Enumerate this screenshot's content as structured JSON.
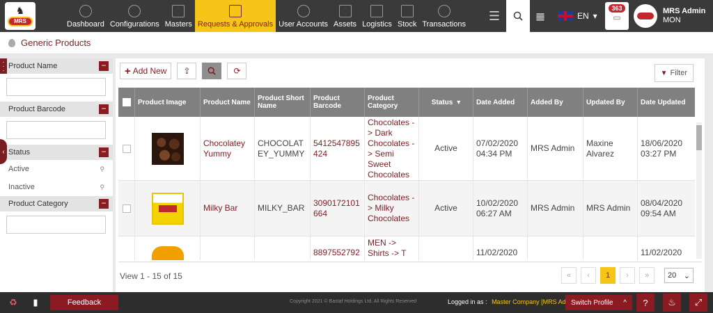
{
  "logo": {
    "text": "MRS"
  },
  "nav": [
    {
      "label": "Dashboard",
      "icon": "dashboard-icon"
    },
    {
      "label": "Configurations",
      "icon": "gears-icon"
    },
    {
      "label": "Masters",
      "icon": "building-icon"
    },
    {
      "label": "Requests & Approvals",
      "icon": "document-check-icon",
      "active": true
    },
    {
      "label": "User Accounts",
      "icon": "users-icon"
    },
    {
      "label": "Assets",
      "icon": "factory-icon"
    },
    {
      "label": "Logistics",
      "icon": "bus-icon"
    },
    {
      "label": "Stock",
      "icon": "stack-icon"
    },
    {
      "label": "Transactions",
      "icon": "exchange-icon"
    }
  ],
  "header": {
    "language": "EN",
    "notification_count": "363",
    "user_name": "MRS Admin",
    "user_org": "MON"
  },
  "page": {
    "title": "Generic Products"
  },
  "filters": {
    "product_name_label": "Product Name",
    "product_barcode_label": "Product Barcode",
    "status_label": "Status",
    "status_options": [
      "Active",
      "Inactive"
    ],
    "product_category_label": "Product Category"
  },
  "toolbar": {
    "add_new_label": "Add New",
    "filter_label": "Filter"
  },
  "table": {
    "columns": [
      "Product Image",
      "Product Name",
      "Product Short Name",
      "Product Barcode",
      "Product Category",
      "Status",
      "Date Added",
      "Added By",
      "Updated By",
      "Date Updated"
    ],
    "rows": [
      {
        "name": "Chocolatey Yummy",
        "short": "CHOCOLAT EY_YUMMY",
        "barcode": "5412547895 424",
        "category": "Chocolates - > Dark Chocolates - > Semi Sweet Chocolates",
        "status": "Active",
        "date_added": "07/02/2020 04:34 PM",
        "added_by": "MRS Admin",
        "updated_by": "Maxine Alvarez",
        "date_updated": "18/06/2020 03:27 PM"
      },
      {
        "name": "Milky Bar",
        "short": "MILKY_BAR",
        "barcode": "3090172101 664",
        "category": "Chocolates - > Milky Chocolates",
        "status": "Active",
        "date_added": "10/02/2020 06:27 AM",
        "added_by": "MRS Admin",
        "updated_by": "MRS Admin",
        "date_updated": "08/04/2020 09:54 AM"
      },
      {
        "name": "",
        "short": "",
        "barcode": "8897552792",
        "category": "MEN -> Shirts -> T",
        "status": "",
        "date_added": "11/02/2020",
        "added_by": "",
        "updated_by": "",
        "date_updated": "11/02/2020"
      }
    ]
  },
  "pager": {
    "view_text": "View 1 - 15 of 15",
    "current_page": "1",
    "page_size": "20"
  },
  "footer": {
    "feedback_label": "Feedback",
    "copyright": "Copyright 2021 © Bastaf Holdings Ltd. All Rights Reserved",
    "logged_in_label": "Logged in as :",
    "logged_in_company": "Master Company [MRS Admin]",
    "switch_profile_label": "Switch Profile"
  }
}
